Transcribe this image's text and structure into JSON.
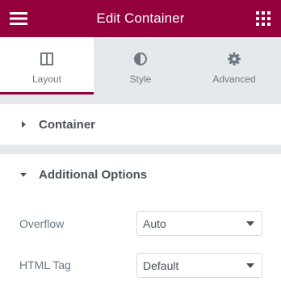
{
  "header": {
    "title": "Edit Container",
    "menu_icon": "hamburger-menu-icon",
    "apps_icon": "grid-apps-icon",
    "background": "#93003c"
  },
  "tabs": [
    {
      "label": "Layout",
      "icon": "columns-layout-icon",
      "active": true
    },
    {
      "label": "Style",
      "icon": "half-circle-contrast-icon",
      "active": false
    },
    {
      "label": "Advanced",
      "icon": "gear-icon",
      "active": false
    }
  ],
  "sections": {
    "container": {
      "title": "Container",
      "expanded": false
    },
    "additional_options": {
      "title": "Additional Options",
      "expanded": true
    }
  },
  "fields": {
    "overflow": {
      "label": "Overflow",
      "value": "Auto"
    },
    "html_tag": {
      "label": "HTML Tag",
      "value": "Default"
    }
  },
  "colors": {
    "accent": "#93003c",
    "panel_background": "#e6e9ec",
    "text": "#6d7882",
    "heading": "#495157"
  }
}
